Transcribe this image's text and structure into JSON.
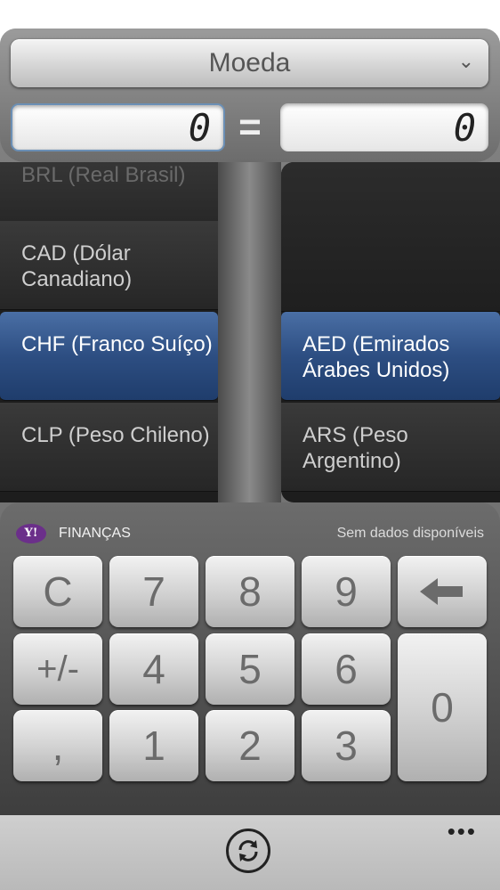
{
  "header": {
    "mode_label": "Moeda",
    "left_value": "0",
    "equals": "=",
    "right_value": "0"
  },
  "left_list": [
    {
      "label": "BRL (Real Brasil)",
      "state": "partial"
    },
    {
      "label": "CAD (Dólar Canadiano)",
      "state": "normal"
    },
    {
      "label": "CHF (Franco Suíço)",
      "state": "selected"
    },
    {
      "label": "CLP (Peso Chileno)",
      "state": "normal"
    }
  ],
  "right_list": [
    {
      "label": "",
      "state": "empty"
    },
    {
      "label": "AED (Emirados Árabes Unidos)",
      "state": "selected"
    },
    {
      "label": "ARS (Peso Argentino)",
      "state": "normal"
    }
  ],
  "source": {
    "logo": "Y!",
    "label": "FINANÇAS",
    "status": "Sem dados disponíveis"
  },
  "keypad": {
    "clear": "C",
    "k7": "7",
    "k8": "8",
    "k9": "9",
    "backspace": "⟵",
    "plusminus": "+/-",
    "k4": "4",
    "k5": "5",
    "k6": "6",
    "k0": "0",
    "comma": ",",
    "k1": "1",
    "k2": "2",
    "k3": "3"
  },
  "appbar": {
    "sync_icon": "sync-icon",
    "more": "•••"
  },
  "colors": {
    "selection": "#2d4e82",
    "brand_yahoo": "#6b2f8a"
  }
}
